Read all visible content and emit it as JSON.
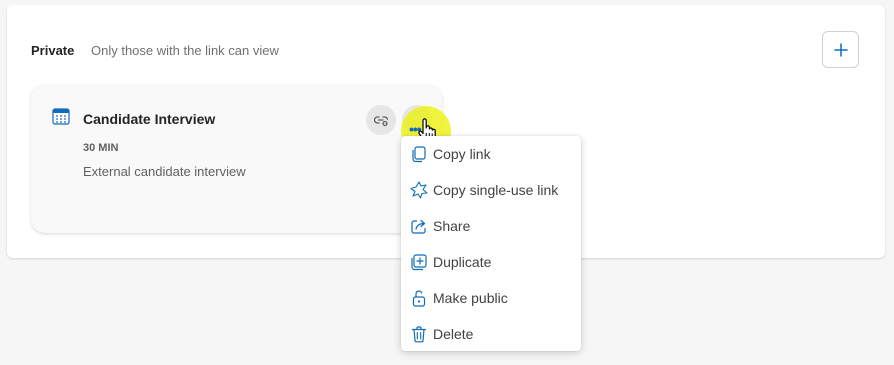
{
  "section": {
    "label": "Private",
    "description": "Only those with the link can view"
  },
  "event_card": {
    "title": "Candidate Interview",
    "duration": "30 MIN",
    "description": "External candidate interview",
    "more_glyph": "•••"
  },
  "menu": {
    "items": [
      {
        "label": "Copy link",
        "icon": "copy-icon"
      },
      {
        "label": "Copy single-use link",
        "icon": "single-use-link-icon"
      },
      {
        "label": "Share",
        "icon": "share-icon"
      },
      {
        "label": "Duplicate",
        "icon": "duplicate-icon"
      },
      {
        "label": "Make public",
        "icon": "unlock-icon"
      },
      {
        "label": "Delete",
        "icon": "trash-icon"
      }
    ]
  },
  "colors": {
    "accent": "#0f6cbd",
    "cursor_highlight": "#eef200",
    "calendar_icon": "#0f6cbd"
  }
}
